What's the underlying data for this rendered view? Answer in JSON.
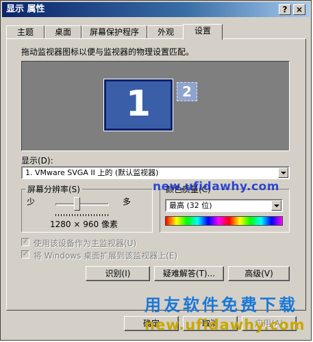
{
  "window": {
    "title": "显示 属性"
  },
  "titlebar_buttons": {
    "help": "?",
    "close": "×"
  },
  "tabs": [
    "主题",
    "桌面",
    "屏幕保护程序",
    "外观",
    "设置"
  ],
  "active_tab": "设置",
  "instruction": "拖动监视器图标以便与监视器的物理设置匹配。",
  "monitors": {
    "primary": "1",
    "secondary": "2"
  },
  "display": {
    "label": "显示(D):",
    "value": "1. VMware SVGA II 上的 (默认监视器)"
  },
  "resolution": {
    "label": "屏幕分辨率(S)",
    "less": "少",
    "more": "多",
    "value": "1280 × 960 像素",
    "slider_position": 0.4
  },
  "color_quality": {
    "label": "颜色质量(C)",
    "value": "最高 (32 位)"
  },
  "checkboxes": {
    "primary": "使用该设备作为主监视器(U)",
    "extend": "将 Windows 桌面扩展到该监视器上(E)"
  },
  "buttons": {
    "identify": "识别(I)",
    "troubleshoot": "疑难解答(T)...",
    "advanced": "高级(V)",
    "ok": "确定",
    "cancel": "取消",
    "apply": "应用(A)"
  },
  "watermarks": {
    "url_top": "new.ufidawhy.com",
    "slogan": "用友软件免费下载",
    "url_bottom": "new.ufidawhy.com"
  },
  "colors": {
    "title_start": "#0a246a",
    "title_end": "#a6caf0",
    "monitor_primary": "#3a5fa8",
    "monitor_area": "#7f7f7f",
    "face": "#d4d0c8"
  }
}
